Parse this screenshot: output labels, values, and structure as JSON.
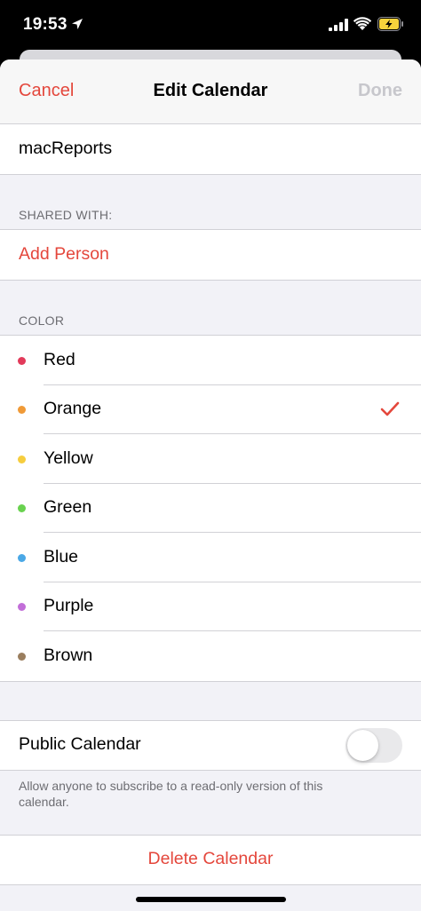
{
  "status": {
    "time": "19:53"
  },
  "nav": {
    "cancel": "Cancel",
    "title": "Edit Calendar",
    "done": "Done"
  },
  "calendar_name": "macReports",
  "shared": {
    "header": "SHARED WITH:",
    "add_person": "Add Person"
  },
  "color": {
    "header": "COLOR",
    "selected": "Orange",
    "options": [
      {
        "label": "Red",
        "hex": "#e23a5a"
      },
      {
        "label": "Orange",
        "hex": "#f09a37"
      },
      {
        "label": "Yellow",
        "hex": "#f6cd3e"
      },
      {
        "label": "Green",
        "hex": "#69d24f"
      },
      {
        "label": "Blue",
        "hex": "#4aa8e6"
      },
      {
        "label": "Purple",
        "hex": "#c26ed8"
      },
      {
        "label": "Brown",
        "hex": "#9a7e5e"
      }
    ]
  },
  "public": {
    "label": "Public Calendar",
    "enabled": false,
    "note": "Allow anyone to subscribe to a read-only version of this calendar."
  },
  "delete_label": "Delete Calendar",
  "accent_color": "#e4473c"
}
